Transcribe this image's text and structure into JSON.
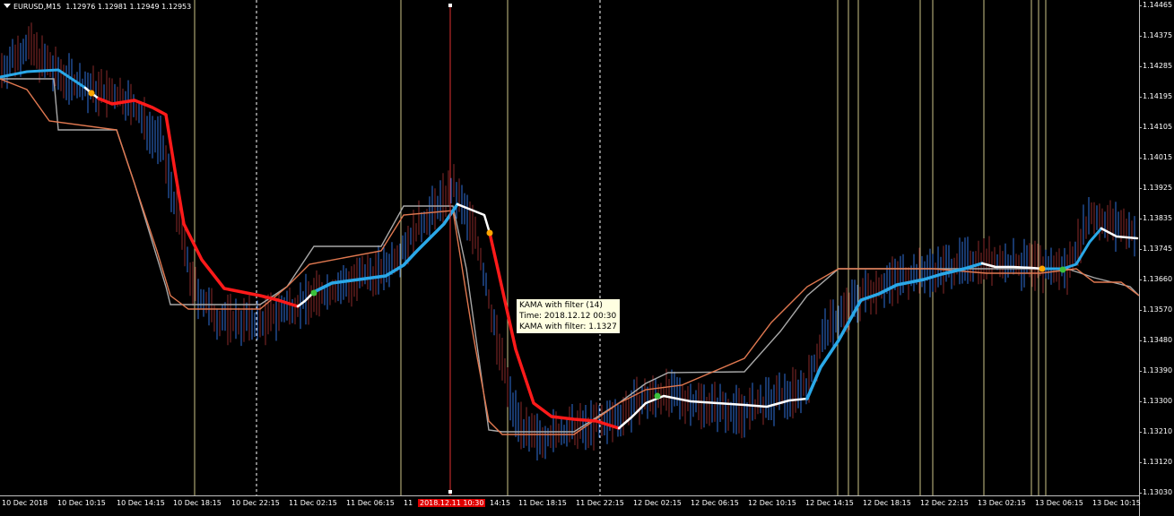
{
  "header": {
    "symbol": "EURUSD,M15",
    "ohlc": "1.12976 1.12981 1.12949 1.12953"
  },
  "price_axis": {
    "labels": [
      "1.14465",
      "1.14375",
      "1.14285",
      "1.14195",
      "1.14105",
      "1.14015",
      "1.13925",
      "1.13835",
      "1.13745",
      "1.13660",
      "1.13570",
      "1.13480",
      "1.13390",
      "1.13300",
      "1.13210",
      "1.13120",
      "1.13030"
    ],
    "top_price": 1.14465,
    "bottom_price": 1.1303
  },
  "time_axis": {
    "labels": [
      "10 Dec 2018",
      "10 Dec 10:15",
      "10 Dec 14:15",
      "10 Dec 18:15",
      "10 Dec 22:15",
      "11 Dec 02:15",
      "11 Dec 06:15",
      "11",
      "2018.12.11 10:30",
      "14:15",
      "11 Dec 18:15",
      "11 Dec 22:15",
      "12 Dec 02:15",
      "12 Dec 06:15",
      "12 Dec 10:15",
      "12 Dec 14:15",
      "12 Dec 18:15",
      "12 Dec 22:15",
      "13 Dec 02:15",
      "13 Dec 06:15",
      "13 Dec 10:15"
    ],
    "highlighted": "2018.12.11 10:30"
  },
  "tooltip": {
    "line1": "KAMA with filter (14)",
    "line2": "Time: 2018.12.12 00:30",
    "line3": "KAMA with filter: 1.1327"
  },
  "colors": {
    "background": "#000000",
    "kama_up": "#2aa8e8",
    "kama_down": "#ff1a1a",
    "kama_flat": "#ffffff",
    "band_upper": "#a8a8a8",
    "band_lower": "#e07850",
    "candle_up": "#2f6fd8",
    "candle_down": "#8a2a2a",
    "vline_solid": "#f0e6a0",
    "vline_dashed": "#ffffff",
    "crosshair": "#e03030",
    "signal_orange": "#ffa500",
    "signal_green": "#3cc03c"
  }
}
